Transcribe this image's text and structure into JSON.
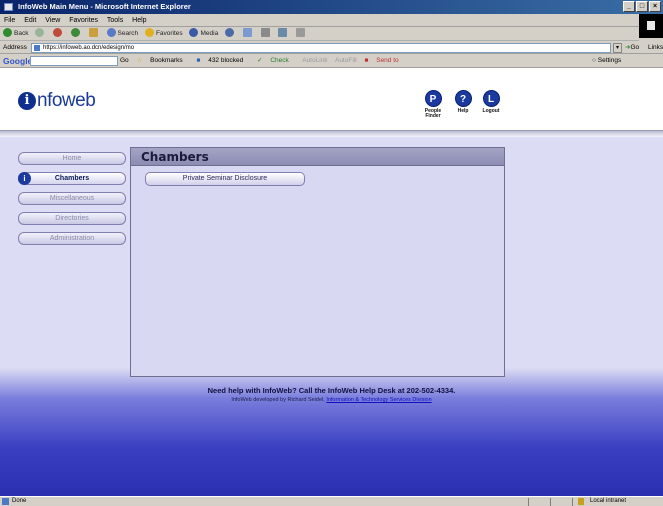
{
  "window": {
    "title": "InfoWeb Main Menu - Microsoft Internet Explorer",
    "buttons": [
      "_",
      "□",
      "×"
    ]
  },
  "menubar": [
    "File",
    "Edit",
    "View",
    "Favorites",
    "Tools",
    "Help"
  ],
  "toolbar": {
    "back": "Back",
    "search": "Search",
    "favorites": "Favorites",
    "media": "Media"
  },
  "address": {
    "label": "Address",
    "url": "https://infoweb.ao.dcn/edesign/mo",
    "go": "Go",
    "links": "Links"
  },
  "google_bar": {
    "logo": "Google G-",
    "go": "Go",
    "bookmarks": "Bookmarks",
    "blocked": "432 blocked",
    "check": "Check",
    "autolink": "AutoLink",
    "autofill": "AutoFill",
    "send_to": "Send to",
    "settings": "Settings"
  },
  "site": {
    "logo_letter": "i",
    "logo_text": "nfoweb",
    "top_nav": [
      {
        "label": "People Finder",
        "icon": "P"
      },
      {
        "label": "Help",
        "icon": "?"
      },
      {
        "label": "Logout",
        "icon": "L"
      }
    ]
  },
  "side_menu": [
    {
      "label": "Home",
      "active": false
    },
    {
      "label": "Chambers",
      "active": true
    },
    {
      "label": "Miscellaneous",
      "active": false
    },
    {
      "label": "Directories",
      "active": false
    },
    {
      "label": "Administration",
      "active": false
    }
  ],
  "panel": {
    "title": "Chambers",
    "button": "Private Seminar Disclosure"
  },
  "footer": {
    "help": "Need help with InfoWeb? Call the InfoWeb Help Desk at 202-502-4334.",
    "dev_prefix": "InfoWeb developed by Richard Seidel,",
    "dev_link": "Information & Technology Services Division"
  },
  "status": {
    "text": "Done",
    "zone": "Local intranet"
  }
}
